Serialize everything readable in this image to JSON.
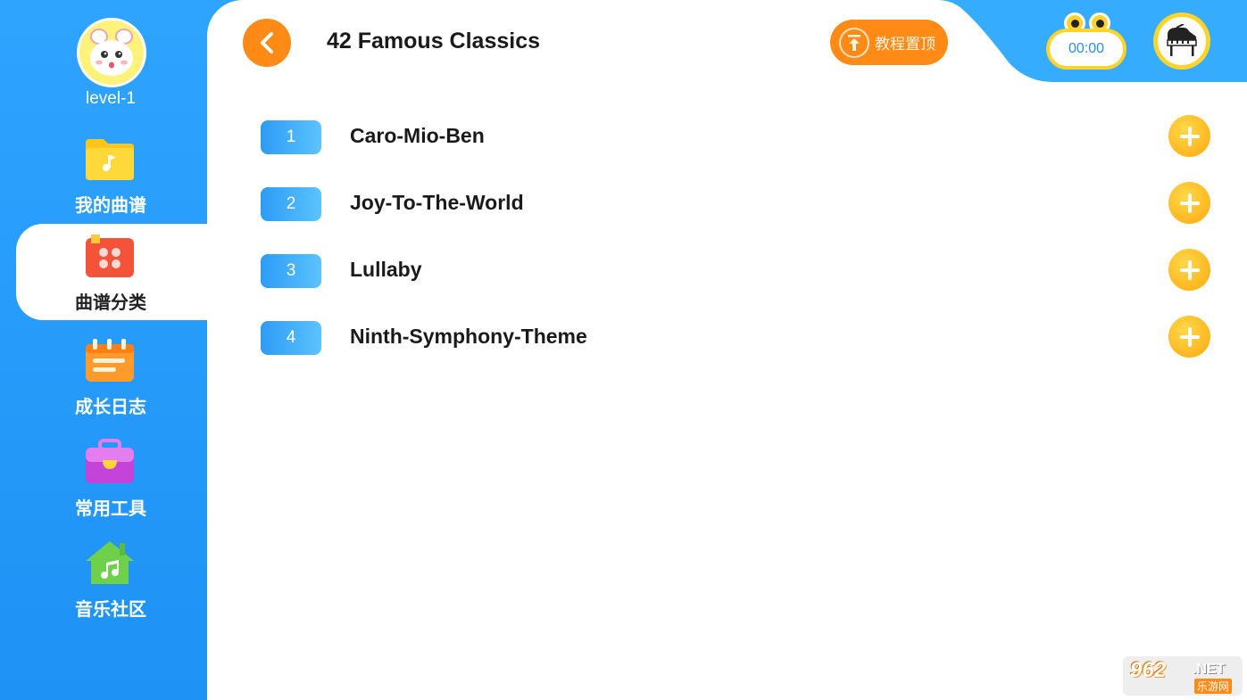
{
  "profile": {
    "level": "level-1",
    "avatar_icon": "hamster-avatar-icon"
  },
  "sidebar": {
    "items": [
      {
        "label": "我的曲谱",
        "icon": "folder-music-icon",
        "active": false
      },
      {
        "label": "曲谱分类",
        "icon": "category-grid-icon",
        "active": true
      },
      {
        "label": "成长日志",
        "icon": "calendar-log-icon",
        "active": false
      },
      {
        "label": "常用工具",
        "icon": "toolbox-icon",
        "active": false
      },
      {
        "label": "音乐社区",
        "icon": "music-house-icon",
        "active": false
      }
    ]
  },
  "header": {
    "title": "42 Famous Classics",
    "pin_label": "教程置顶",
    "timer": "00:00",
    "back_icon": "chevron-left-icon",
    "piano_icon": "piano-icon"
  },
  "songs": [
    {
      "number": "1",
      "title": "Caro-Mio-Ben"
    },
    {
      "number": "2",
      "title": "Joy-To-The-World"
    },
    {
      "number": "3",
      "title": "Lullaby"
    },
    {
      "number": "4",
      "title": "Ninth-Symphony-Theme"
    }
  ],
  "watermark": {
    "brand": "962",
    "suffix": ".NET",
    "sub": "乐游网"
  },
  "colors": {
    "sidebar_blue": "#2ea4ff",
    "accent_orange": "#ff8a15",
    "add_yellow": "#ffc42a",
    "number_badge": "#2d9cf5"
  }
}
